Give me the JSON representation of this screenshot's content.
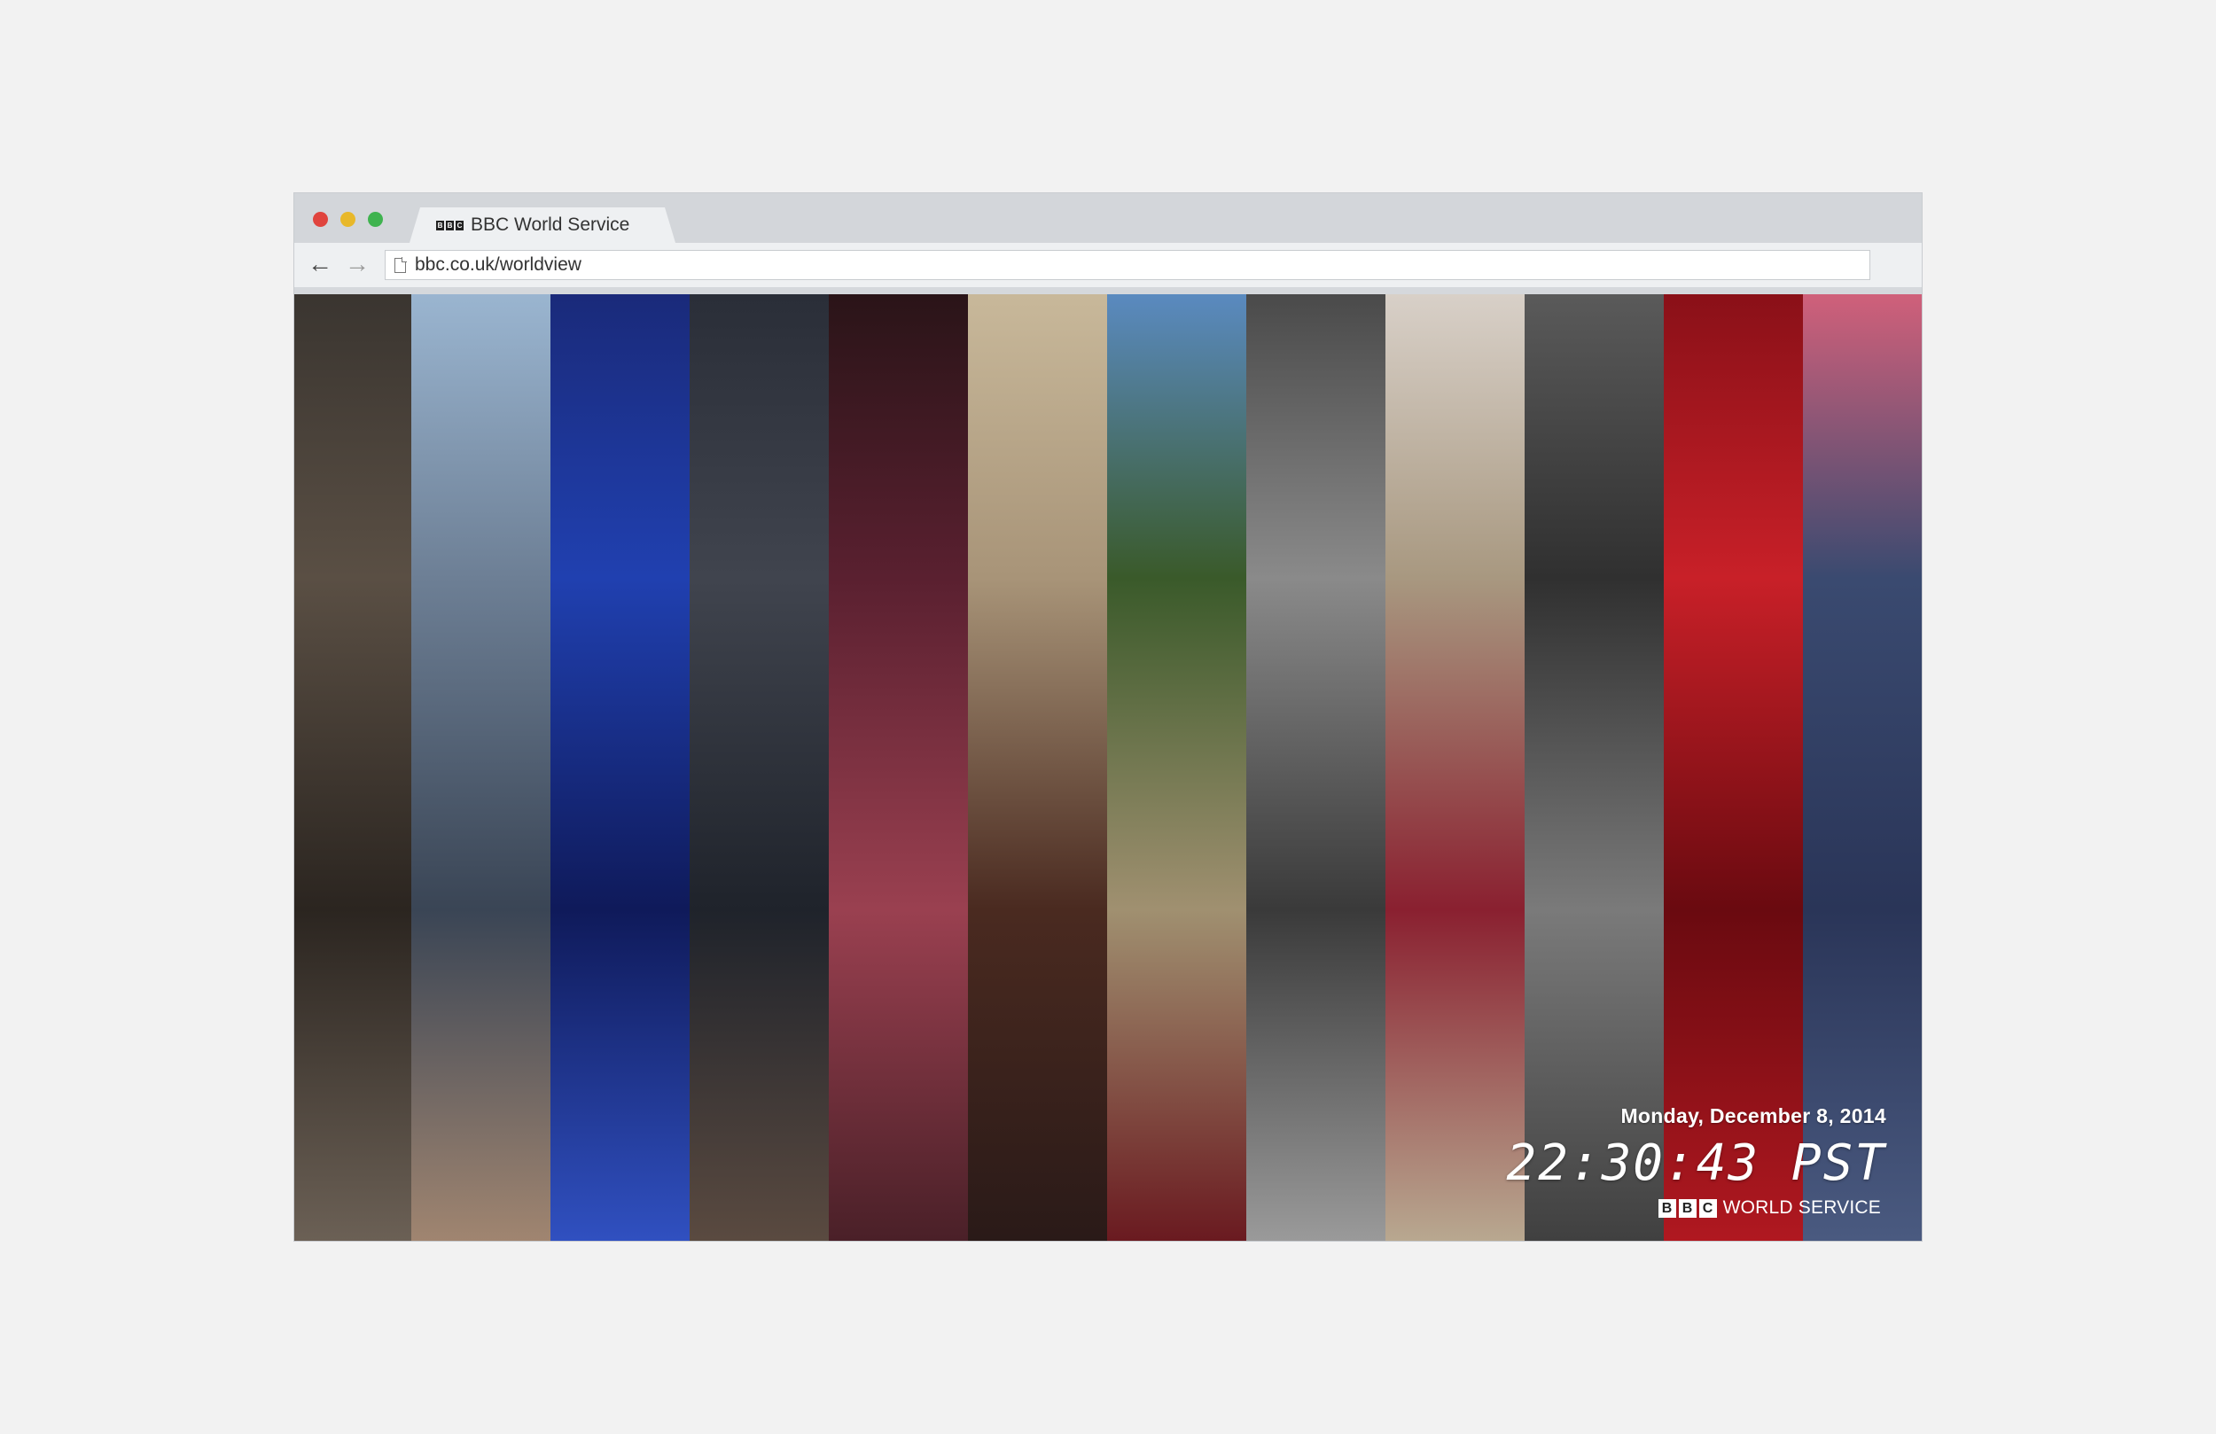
{
  "browser": {
    "tab_title": "BBC World Service",
    "favicon_letters": [
      "B",
      "B",
      "C"
    ],
    "url": "bbc.co.uk/worldview",
    "nav": {
      "back_icon": "arrow-left",
      "forward_icon": "arrow-right"
    }
  },
  "overlay": {
    "date": "Monday, December 8, 2014",
    "time": "22:30:43 PST",
    "brand_letters": [
      "B",
      "B",
      "C"
    ],
    "brand_text": "WORLD SERVICE"
  },
  "strips": [
    {
      "name": "strip-mud-figure",
      "colors": [
        "#3a3530",
        "#5a4f44",
        "#2b2520",
        "#6b6055"
      ]
    },
    {
      "name": "strip-raised-arm",
      "colors": [
        "#9ab5d0",
        "#6d7f95",
        "#3a4555",
        "#a08570"
      ]
    },
    {
      "name": "strip-confetti",
      "colors": [
        "#1a2a7a",
        "#2040b0",
        "#0f1a5a",
        "#3050c0"
      ]
    },
    {
      "name": "strip-riot-police",
      "colors": [
        "#2a2e38",
        "#40444e",
        "#1f232b",
        "#5a4a40"
      ]
    },
    {
      "name": "strip-crowd-flares",
      "colors": [
        "#2a1418",
        "#5a2030",
        "#9a4050",
        "#4a2028"
      ]
    },
    {
      "name": "strip-graffiti-man",
      "colors": [
        "#c8b89a",
        "#a89478",
        "#4a2a20",
        "#2a1a18"
      ]
    },
    {
      "name": "strip-tomato-field",
      "colors": [
        "#5a8ac0",
        "#3a5a2a",
        "#a09070",
        "#6a1a20"
      ]
    },
    {
      "name": "strip-bw-portrait",
      "colors": [
        "#4a4a4a",
        "#8a8a8a",
        "#3a3a3a",
        "#9a9a9a"
      ]
    },
    {
      "name": "strip-child-dirt",
      "colors": [
        "#d8d0c8",
        "#a89880",
        "#8a2030",
        "#b8a890"
      ]
    },
    {
      "name": "strip-police-crowd",
      "colors": [
        "#5a5a5a",
        "#303030",
        "#7a7a7a",
        "#404040"
      ]
    },
    {
      "name": "strip-tomato-splash",
      "colors": [
        "#8a1018",
        "#c82028",
        "#6a0a10",
        "#b01820"
      ]
    },
    {
      "name": "strip-school-kids",
      "colors": [
        "#d0607a",
        "#3a4a70",
        "#2a3558",
        "#4a5a80"
      ]
    }
  ]
}
